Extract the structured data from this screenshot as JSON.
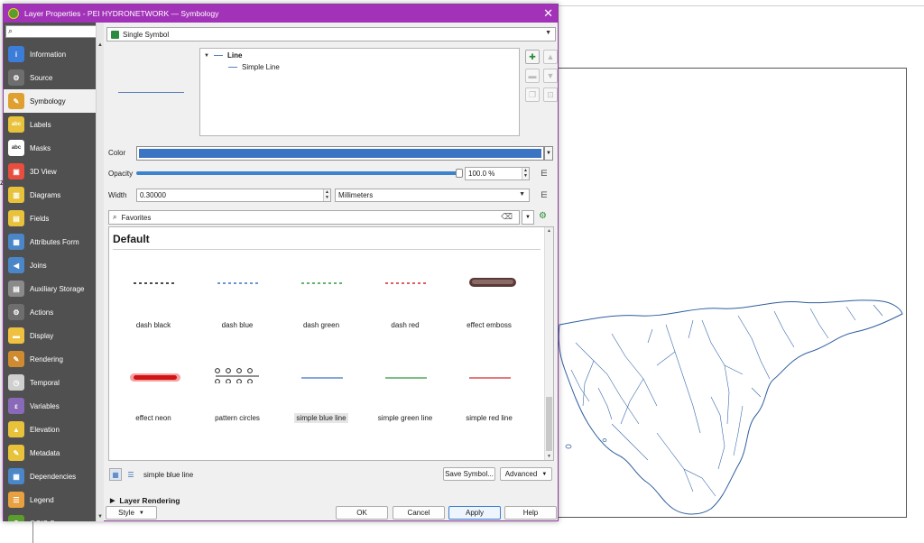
{
  "window": {
    "title": "Layer Properties - PEI HYDRONETWORK — Symbology",
    "close_glyph": "✕"
  },
  "sidebar": {
    "search_placeholder": "",
    "items": [
      {
        "label": "Information",
        "icon": "info-icon",
        "color": "#3b7dd8"
      },
      {
        "label": "Source",
        "icon": "source-icon",
        "color": "#6e6e6e"
      },
      {
        "label": "Symbology",
        "icon": "symbology-brush-icon",
        "color": "#e0a030",
        "active": true
      },
      {
        "label": "Labels",
        "icon": "labels-abc-icon",
        "color": "#e8c23a"
      },
      {
        "label": "Masks",
        "icon": "masks-abc-icon",
        "color": "#ffffff"
      },
      {
        "label": "3D View",
        "icon": "cube-icon",
        "color": "#e84d3d"
      },
      {
        "label": "Diagrams",
        "icon": "diagrams-icon",
        "color": "#e8c23a"
      },
      {
        "label": "Fields",
        "icon": "fields-icon",
        "color": "#e8c23a"
      },
      {
        "label": "Attributes Form",
        "icon": "form-icon",
        "color": "#4a86c8"
      },
      {
        "label": "Joins",
        "icon": "joins-icon",
        "color": "#4a86c8"
      },
      {
        "label": "Auxiliary Storage",
        "icon": "storage-icon",
        "color": "#8a8a8a"
      },
      {
        "label": "Actions",
        "icon": "actions-gear-icon",
        "color": "#6e6e6e"
      },
      {
        "label": "Display",
        "icon": "display-bubble-icon",
        "color": "#f0c040"
      },
      {
        "label": "Rendering",
        "icon": "rendering-brush-icon",
        "color": "#d08a30"
      },
      {
        "label": "Temporal",
        "icon": "clock-icon",
        "color": "#cfcfcf"
      },
      {
        "label": "Variables",
        "icon": "variables-icon",
        "color": "#8a6ab8"
      },
      {
        "label": "Elevation",
        "icon": "elevation-icon",
        "color": "#e8c23a"
      },
      {
        "label": "Metadata",
        "icon": "metadata-icon",
        "color": "#e8c23a"
      },
      {
        "label": "Dependencies",
        "icon": "dependencies-icon",
        "color": "#4a86c8"
      },
      {
        "label": "Legend",
        "icon": "legend-icon",
        "color": "#e8a040"
      },
      {
        "label": "QGIS S",
        "icon": "qgis-server-icon",
        "color": "#5b9c2e"
      }
    ]
  },
  "renderer": {
    "selected": "Single Symbol"
  },
  "symbol_tree": {
    "root": "Line",
    "child": "Simple Line"
  },
  "props": {
    "color_label": "Color",
    "color_value": "#3a74c2",
    "opacity_label": "Opacity",
    "opacity_value": "100.0 %",
    "opacity_fraction": 1.0,
    "width_label": "Width",
    "width_value": "0.30000",
    "unit": "Millimeters"
  },
  "library": {
    "filter": "Favorites",
    "group_title": "Default",
    "symbols": [
      {
        "name": "dash  black",
        "color": "#111111",
        "kind": "dash"
      },
      {
        "name": "dash blue",
        "color": "#3a74c2",
        "kind": "dash"
      },
      {
        "name": "dash green",
        "color": "#2f9a3a",
        "kind": "dash"
      },
      {
        "name": "dash red",
        "color": "#d42a2a",
        "kind": "dash"
      },
      {
        "name": "effect emboss",
        "color": "#5a3a36",
        "kind": "emboss"
      },
      {
        "name": "effect neon",
        "color": "#d01515",
        "kind": "neon"
      },
      {
        "name": "pattern circles",
        "color": "#222222",
        "kind": "circles"
      },
      {
        "name": "simple blue line",
        "color": "#3a74c2",
        "kind": "solid",
        "selected": true
      },
      {
        "name": "simple green line",
        "color": "#2f9a3a",
        "kind": "solid"
      },
      {
        "name": "simple red line",
        "color": "#d42a2a",
        "kind": "solid"
      }
    ],
    "selected_name": "simple blue line",
    "save_label": "Save Symbol...",
    "advanced_label": "Advanced"
  },
  "layer_rendering": "Layer Rendering",
  "footer": {
    "style": "Style",
    "ok": "OK",
    "cancel": "Cancel",
    "apply": "Apply",
    "help": "Help"
  },
  "background": {
    "z_label": "z"
  }
}
